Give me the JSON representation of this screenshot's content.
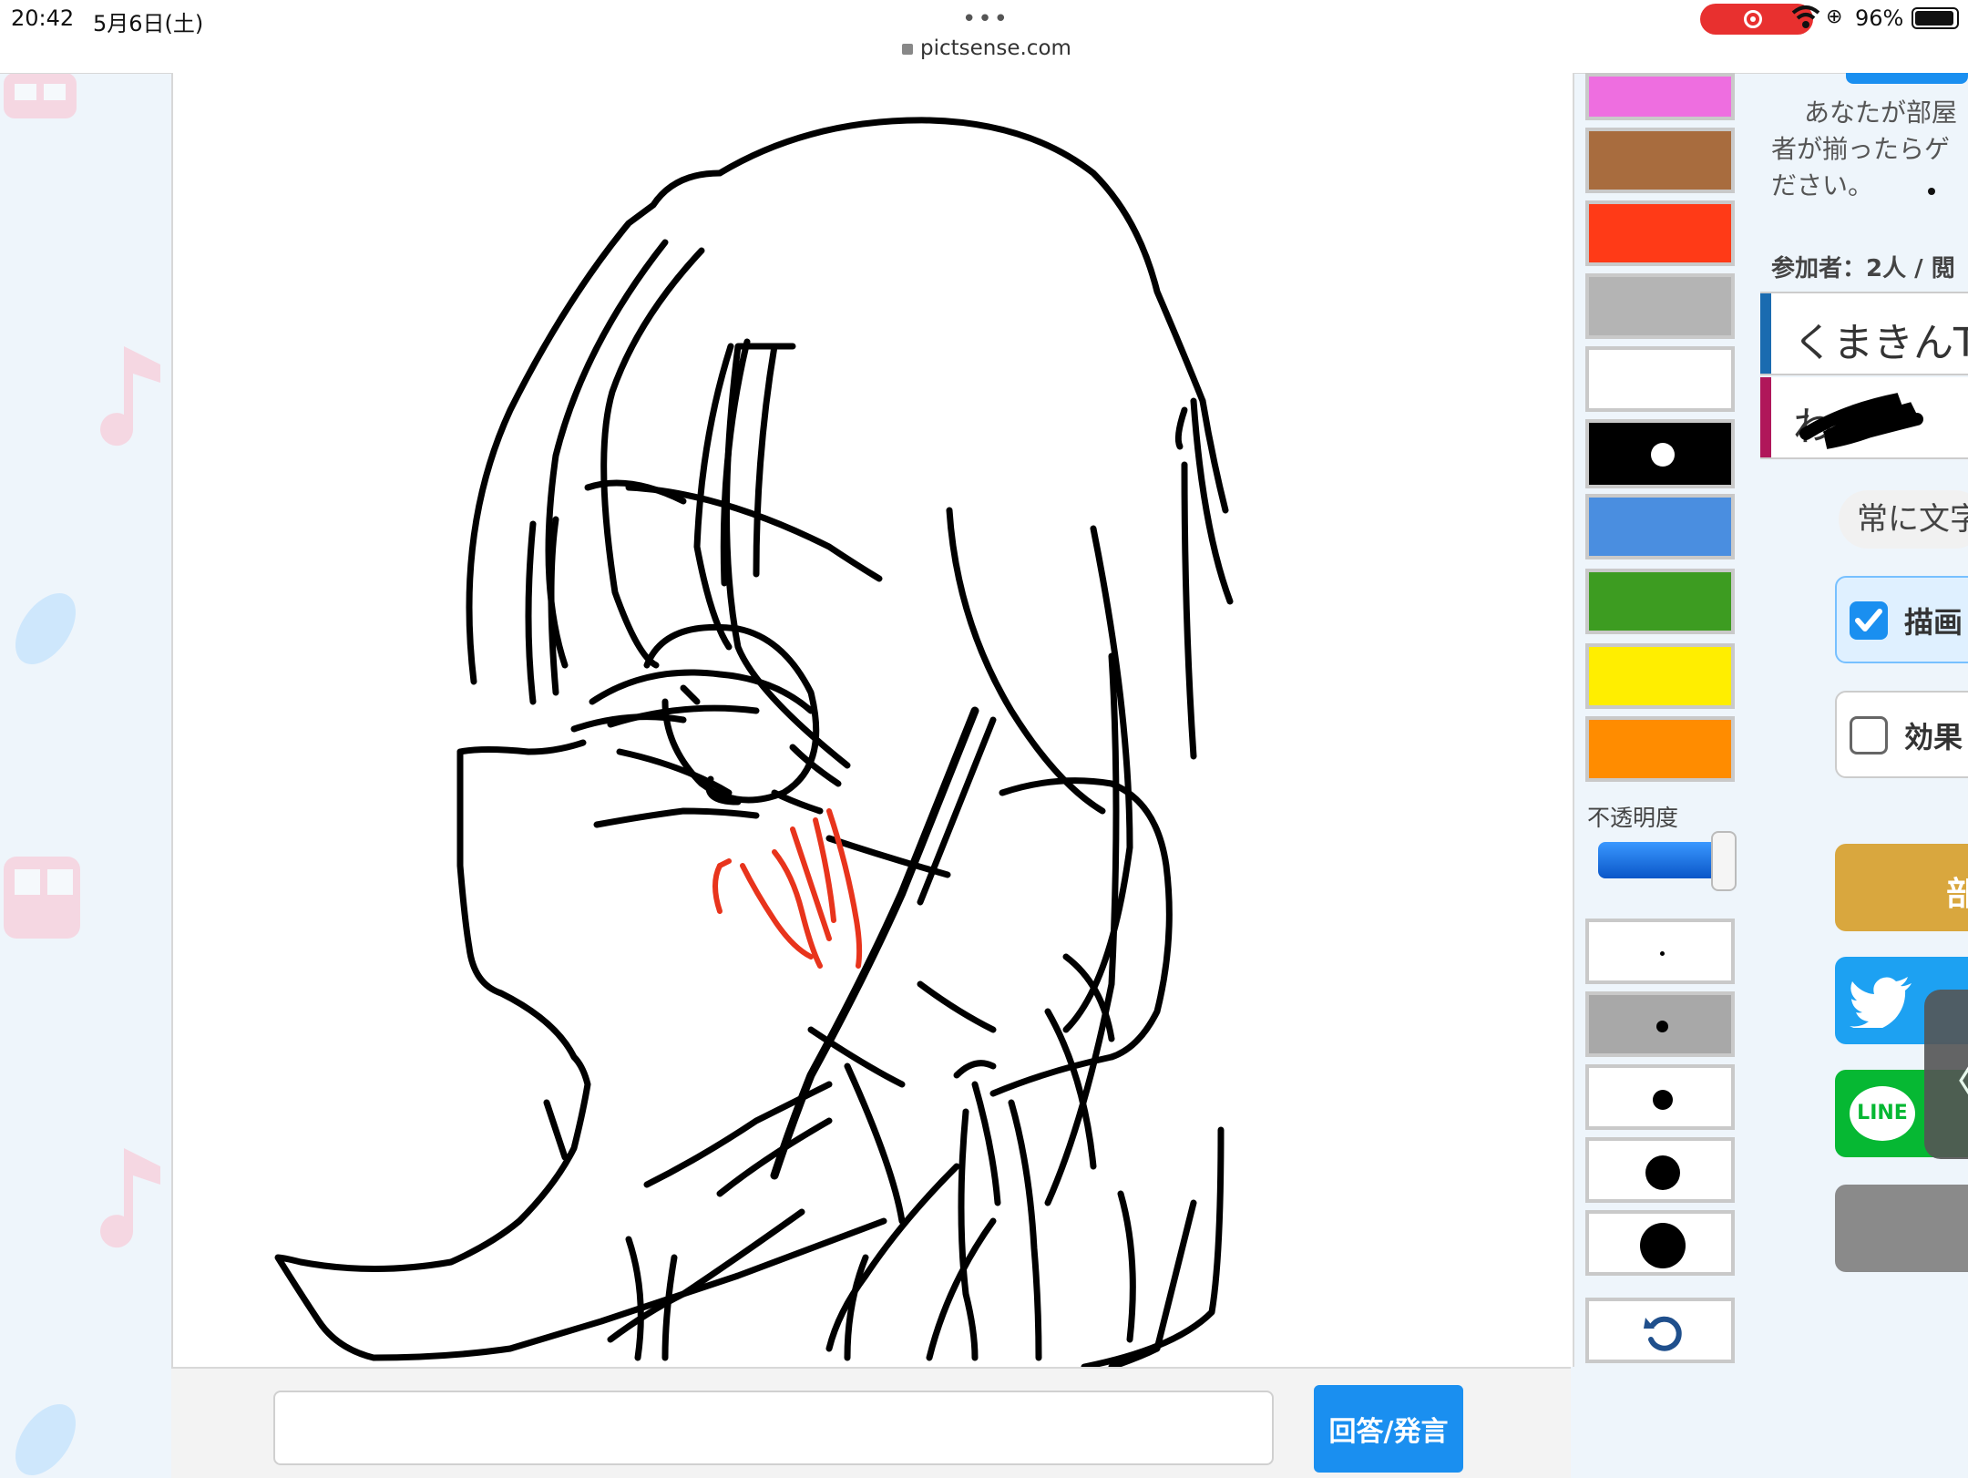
{
  "status_bar": {
    "time": "20:42",
    "date": "5月6日(土)",
    "url": "pictsense.com",
    "battery": "96%",
    "recording": true
  },
  "canvas": {
    "stroke_color": "#000000",
    "blush_color": "#e8341c"
  },
  "input_bar": {
    "answer_placeholder": "",
    "answer_button": "回答/発言"
  },
  "palette": {
    "colors": [
      {
        "name": "pink",
        "hex": "#ee6ee0"
      },
      {
        "name": "brown",
        "hex": "#a86c3e"
      },
      {
        "name": "red",
        "hex": "#ff3a17"
      },
      {
        "name": "gray",
        "hex": "#b4b4b4"
      },
      {
        "name": "white",
        "hex": "#ffffff"
      },
      {
        "name": "black",
        "hex": "#000000",
        "selected": true
      },
      {
        "name": "blue",
        "hex": "#4a8ee0"
      },
      {
        "name": "green",
        "hex": "#3d9c21"
      },
      {
        "name": "yellow",
        "hex": "#ffee00"
      },
      {
        "name": "orange",
        "hex": "#ff8c00"
      }
    ],
    "opacity_label": "不透明度",
    "opacity_value": 0.9,
    "brush_sizes": [
      "size-1",
      "size-2",
      "size-3",
      "size-4",
      "size-5"
    ],
    "selected_size": "size-2",
    "undo_icon": "undo-icon"
  },
  "info_panel": {
    "description_lines": [
      "あなたが部屋",
      "者が揃ったらゲ",
      "ださい。"
    ],
    "participants": "参加者：2人 / 閲",
    "players": [
      {
        "name": "くまきんT",
        "color": "#1a6bb0"
      },
      {
        "name": "わ",
        "color": "#b0175a"
      }
    ],
    "always_text_option": "常に文字",
    "draw_checkbox": {
      "label": "描画",
      "checked": true
    },
    "effect_checkbox": {
      "label": "効果",
      "checked": false
    },
    "room_button": "部",
    "twitter_icon": "twitter-icon",
    "line_icon": "line-icon",
    "line_label": "LINE",
    "collapse_label": "〈"
  }
}
